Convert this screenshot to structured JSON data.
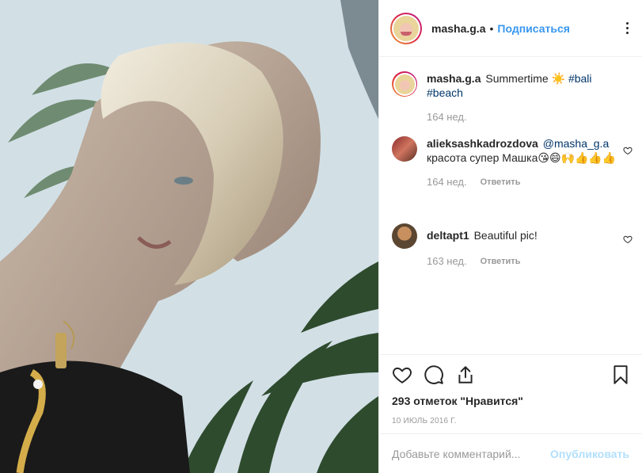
{
  "post": {
    "author": "masha.g.a",
    "header_dot": "•",
    "follow_label": "Подписаться"
  },
  "comments": [
    {
      "username": "masha.g.a",
      "text": "Summertime ☀️",
      "tags": "#bali #beach",
      "time": "164 нед."
    },
    {
      "username": "alieksashkadrozdova",
      "mention": "@masha_g.a",
      "text": "красота супер Машка😘😄🙌👍👍👍",
      "time": "164 нед.",
      "reply_label": "Ответить"
    },
    {
      "username": "deltapt1",
      "text": "Beautiful pic!",
      "time": "163 нед.",
      "reply_label": "Ответить"
    }
  ],
  "actions": {
    "likes_text": "293 отметок \"Нравится\"",
    "date": "10 июль 2016 г.",
    "icons": [
      "heart-icon",
      "comment-icon",
      "share-icon",
      "bookmark-icon"
    ]
  },
  "add_comment": {
    "placeholder": "Добавьте комментарий...",
    "publish_label": "Опубликовать"
  },
  "colors": {
    "link": "#3897f0",
    "hashtag": "#003569",
    "muted": "#999999",
    "publish_disabled": "#b2dffc"
  }
}
